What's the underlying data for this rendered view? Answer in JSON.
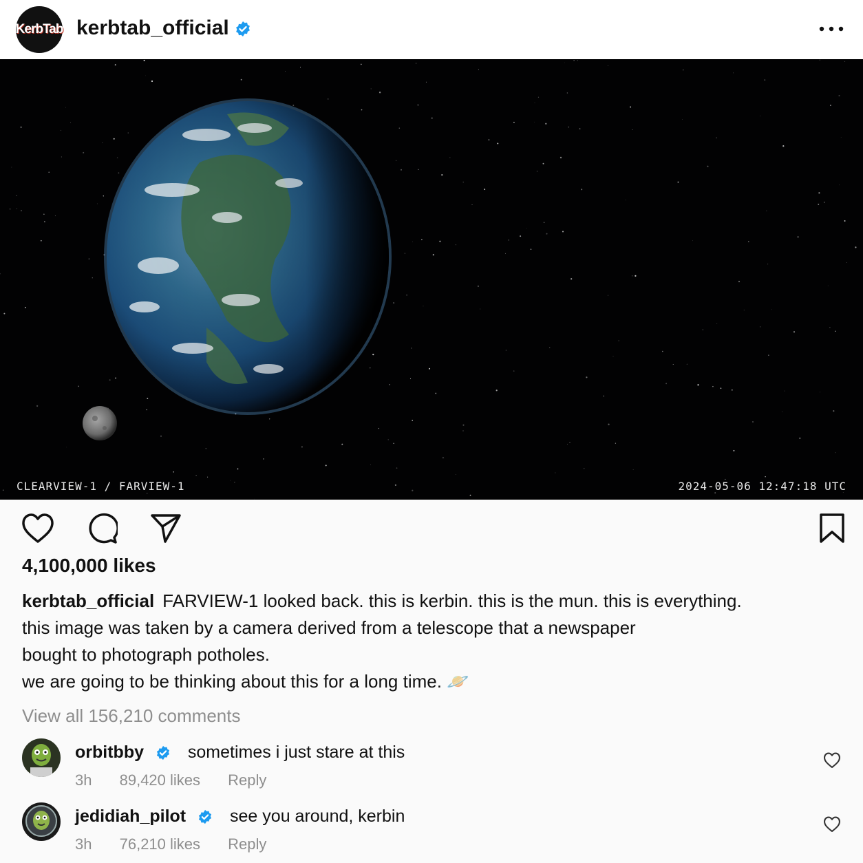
{
  "header": {
    "avatar_text": "KerbTab",
    "username": "kerbtab_official"
  },
  "post": {
    "overlay_left": "CLEARVIEW-1 / FARVIEW-1",
    "overlay_right": "2024-05-06 12:47:18 UTC"
  },
  "likes": "4,100,000 likes",
  "caption": {
    "username": "kerbtab_official",
    "line1": "FARVIEW-1 looked back. this is kerbin. this is the mun. this is everything.",
    "line2": "this image was taken by a camera derived from a telescope that a newspaper",
    "line3": "bought to photograph potholes.",
    "line4": "we are going to be thinking about this for a long time. 🪐"
  },
  "view_all": "View all 156,210 comments",
  "comments": [
    {
      "username": "orbitbby",
      "text": "sometimes i just stare at this",
      "time": "3h",
      "likes": "89,420 likes",
      "reply": "Reply"
    },
    {
      "username": "jedidiah_pilot",
      "text": "see you around, kerbin",
      "time": "3h",
      "likes": "76,210 likes",
      "reply": "Reply"
    }
  ],
  "icons": [
    "verified-badge-icon",
    "more-options-icon",
    "heart-icon",
    "comment-icon",
    "share-icon",
    "bookmark-icon"
  ],
  "colors": {
    "verified": "#1d9bf0",
    "muted": "#8e8e8e",
    "post_bg": "#020203"
  }
}
